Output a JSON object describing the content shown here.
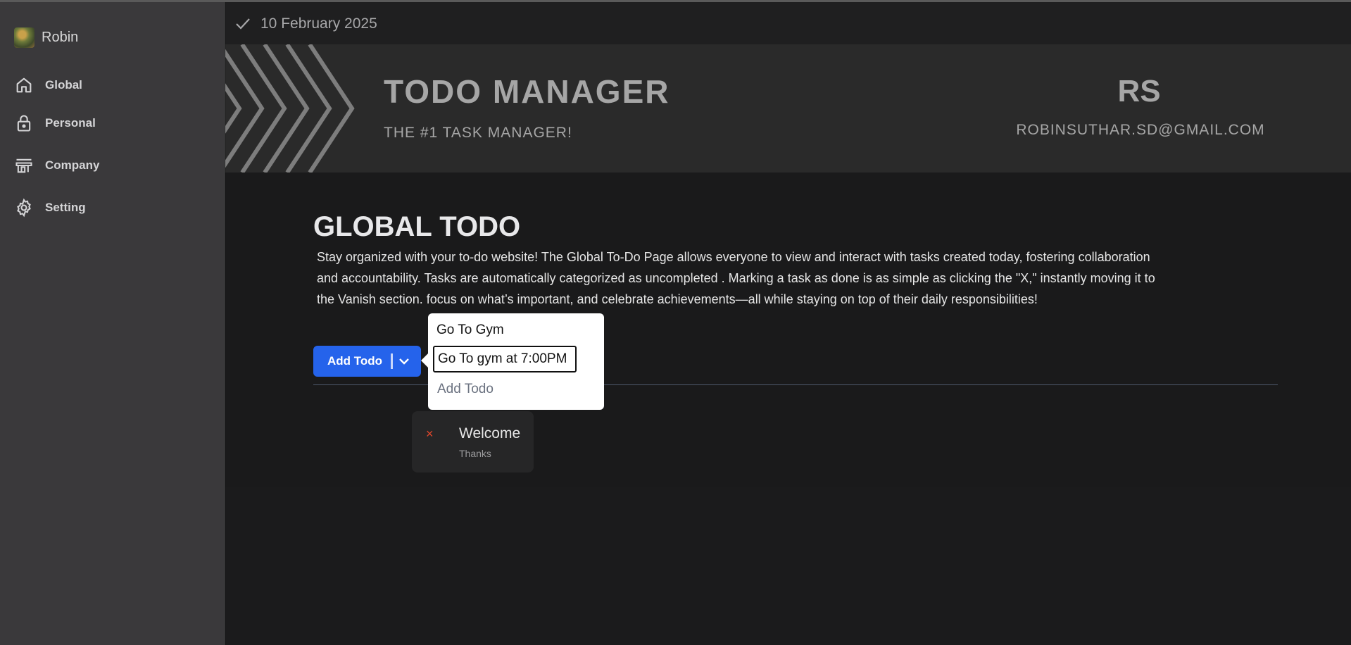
{
  "sidebar": {
    "profile_name": "Robin",
    "items": [
      {
        "label": "Global",
        "icon": "home-icon"
      },
      {
        "label": "Personal",
        "icon": "lock-icon"
      },
      {
        "label": "Company",
        "icon": "store-icon"
      },
      {
        "label": "Setting",
        "icon": "gear-icon"
      }
    ]
  },
  "header": {
    "date": "10 February 2025"
  },
  "banner": {
    "title": "TODO MANAGER",
    "subtitle": "THE #1 TASK MANAGER!",
    "initials": "RS",
    "email": "ROBINSUTHAR.SD@GMAIL.COM"
  },
  "main": {
    "title": "GLOBAL TODO",
    "description": "Stay organized with your to-do website! The Global To-Do Page allows everyone to view and interact with tasks created today, fostering collaboration and accountability. Tasks are automatically categorized as uncompleted . Marking a task as done is as simple as clicking the \"X,\" instantly moving it to the Vanish section. focus on what’s important, and celebrate achievements—all while staying on top of their daily responsibilities!",
    "add_button_label": "Add Todo"
  },
  "popup": {
    "title_value": "Go To Gym",
    "description_value": "Go To gym at 7:00PM",
    "add_label": "Add Todo"
  },
  "todos": [
    {
      "title": "Welcome",
      "subtitle": "Thanks",
      "action": "×"
    }
  ],
  "colors": {
    "accent": "#2563eb",
    "sidebar_bg": "#3a393b",
    "banner_bg": "#2a2a2a",
    "delete": "#e0462b"
  }
}
